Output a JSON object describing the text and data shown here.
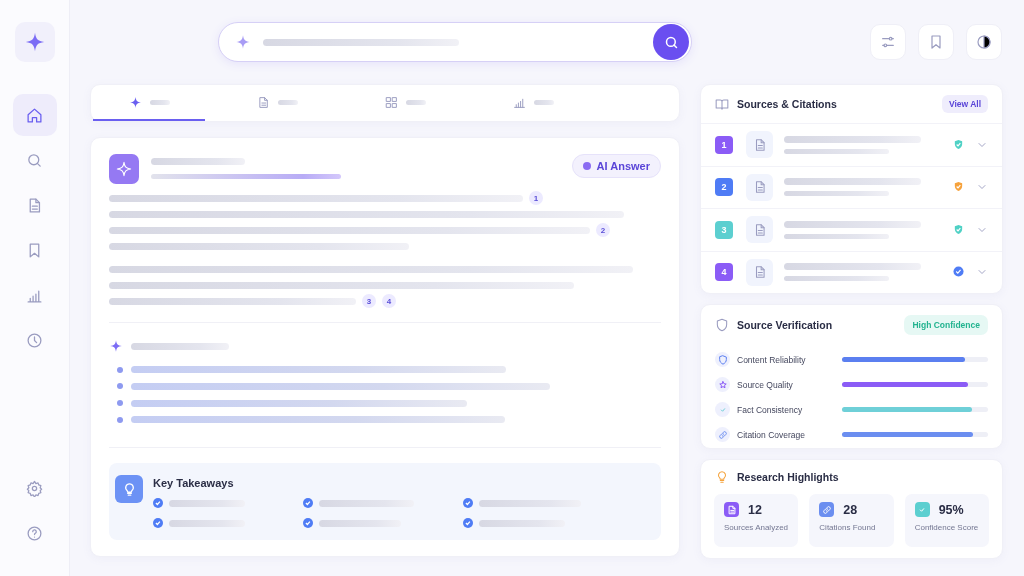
{
  "sidebar": {
    "items": [
      {
        "selected": true
      },
      {
        "selected": false
      },
      {
        "selected": false
      },
      {
        "selected": false
      },
      {
        "selected": false
      },
      {
        "selected": false
      }
    ],
    "bottom_items": [
      {
        "selected": false
      },
      {
        "selected": false
      }
    ]
  },
  "tabs": [
    {
      "selected": true
    },
    {
      "selected": false
    },
    {
      "selected": false
    },
    {
      "selected": false
    }
  ],
  "answer": {
    "badge": "AI Answer",
    "citations": [
      "1",
      "2",
      "3",
      "4"
    ],
    "takeaways": {
      "title": "Key Takeaways"
    }
  },
  "sources": {
    "title": "Sources & Citations",
    "action": "View All",
    "items": [
      {
        "number": {
          "text": "1",
          "color": "#8b5cf6"
        },
        "status": {
          "kind": "shield",
          "color": "#4fd1c5"
        }
      },
      {
        "number": {
          "text": "2",
          "color": "#4f7cf5"
        },
        "status": {
          "kind": "shield",
          "color": "#f6a23c"
        }
      },
      {
        "number": {
          "text": "3",
          "color": "#5ccfd0"
        },
        "status": {
          "kind": "shield",
          "color": "#4fd1c5"
        }
      },
      {
        "number": {
          "text": "4",
          "color": "#8b5cf6"
        },
        "status": {
          "kind": "circle",
          "color": "#4f7cf5"
        }
      }
    ]
  },
  "verification": {
    "title": "Source Verification",
    "badge": "High Confidence",
    "metrics": [
      {
        "label": "Content Reliability",
        "level": 0.84,
        "color": "#5b7ff0"
      },
      {
        "label": "Source Quality",
        "level": 0.86,
        "color": "#8b5cf6"
      },
      {
        "label": "Fact Consistency",
        "level": 0.89,
        "color": "#6fd0d8"
      },
      {
        "label": "Citation Coverage",
        "level": 0.9,
        "color": "#6b8ef0"
      }
    ]
  },
  "highlights": {
    "title": "Research Highlights",
    "stats": [
      {
        "value": "12",
        "label": "Sources Analyzed",
        "color": "#8b5cf6"
      },
      {
        "value": "28",
        "label": "Citations Found",
        "color": "#6b8ef0"
      },
      {
        "value": "95%",
        "label": "Confidence Score",
        "color": "#5ccfd0"
      }
    ]
  }
}
